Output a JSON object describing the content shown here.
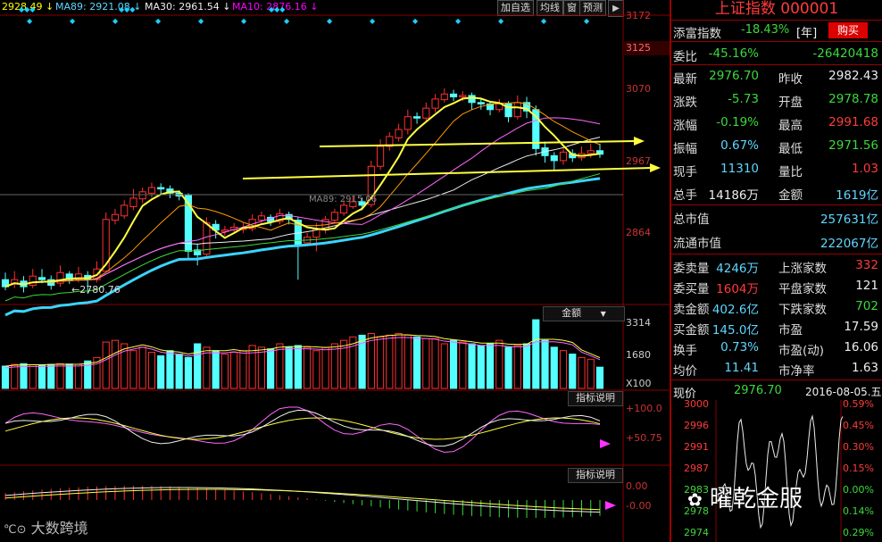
{
  "header": {
    "ma_items": [
      {
        "text": "2928.49 ↓",
        "color": "#ff0"
      },
      {
        "text": "MA89: 2921.08 ↓",
        "color": "#5fd7ff"
      },
      {
        "text": "MA30: 2961.54 ↓",
        "color": "#eee"
      },
      {
        "text": "MA10: 2876.16 ↓",
        "color": "#f0f"
      }
    ],
    "buttons": [
      "加自选",
      "均线",
      "窗",
      "预测"
    ],
    "nav_arrow": "▶"
  },
  "price_axis": [
    "3172",
    "3125",
    "3070",
    "2967",
    "2864"
  ],
  "low_annotation": "←2780.76",
  "ma_annotation": "MA89: 2915.06",
  "volume_panel": {
    "label": "金额",
    "axis": [
      "3314",
      "1680",
      "X100"
    ]
  },
  "indicator1": {
    "label": "指标说明",
    "axis": [
      "+100.0",
      "+50.75"
    ]
  },
  "indicator2": {
    "label": "指标说明",
    "axis": [
      "0.00",
      "-0.00"
    ]
  },
  "watermark_left": "大数跨境",
  "watermark_right": "曜乾金服",
  "quote": {
    "title": "上证指数 000001",
    "buy_label": "添富指数",
    "buy_value": "-18.43%",
    "buy_unit": "[年]",
    "buy_button": "购买",
    "rows1": [
      {
        "l": "委比",
        "v": "-45.16%",
        "vc": "grn",
        "l2": "",
        "v2": "-26420418",
        "v2c": "grn"
      }
    ],
    "rows2": [
      {
        "l": "最新",
        "v": "2976.70",
        "vc": "grn",
        "l2": "昨收",
        "v2": "2982.43",
        "v2c": "wht"
      },
      {
        "l": "涨跌",
        "v": "-5.73",
        "vc": "grn",
        "l2": "开盘",
        "v2": "2978.78",
        "v2c": "grn"
      },
      {
        "l": "涨幅",
        "v": "-0.19%",
        "vc": "grn",
        "l2": "最高",
        "v2": "2991.68",
        "v2c": "red"
      },
      {
        "l": "振幅",
        "v": "0.67%",
        "vc": "cy",
        "l2": "最低",
        "v2": "2971.56",
        "v2c": "grn"
      },
      {
        "l": "现手",
        "v": "11310",
        "vc": "cy",
        "l2": "量比",
        "v2": "1.03",
        "v2c": "red"
      },
      {
        "l": "总手",
        "v": "14186万",
        "vc": "wht",
        "l2": "金额",
        "v2": "1619亿",
        "v2c": "cy"
      }
    ],
    "rows3": [
      {
        "l": "总市值",
        "v2": "257631亿",
        "v2c": "cy"
      },
      {
        "l": "流通市值",
        "v2": "222067亿",
        "v2c": "cy"
      }
    ],
    "rows4": [
      {
        "l": "委卖量",
        "v": "4246万",
        "vc": "cy",
        "l2": "上涨家数",
        "v2": "332",
        "v2c": "red"
      },
      {
        "l": "委买量",
        "v": "1604万",
        "vc": "red",
        "l2": "平盘家数",
        "v2": "121",
        "v2c": "wht"
      },
      {
        "l": "卖金额",
        "v": "402.6亿",
        "vc": "cy",
        "l2": "下跌家数",
        "v2": "702",
        "v2c": "grn"
      },
      {
        "l": "买金额",
        "v": "145.0亿",
        "vc": "cy",
        "l2": "市盈",
        "v2": "17.59",
        "v2c": "wht"
      },
      {
        "l": "换手",
        "v": "0.73%",
        "vc": "cy",
        "l2": "市盈(动)",
        "v2": "16.06",
        "v2c": "wht"
      },
      {
        "l": "均价",
        "v": "11.41",
        "vc": "cy",
        "l2": "市净率",
        "v2": "1.63",
        "v2c": "wht"
      }
    ],
    "mini": {
      "label": "现价",
      "price": "2976.70",
      "date": "2016-08-05.五",
      "left_axis": [
        "3000",
        "2996",
        "2991",
        "2987",
        "2983",
        "2978",
        "2974"
      ],
      "right_axis": [
        "0.59%",
        "0.45%",
        "0.30%",
        "0.15%",
        "0.00%",
        "0.14%",
        "0.29%"
      ]
    }
  },
  "chart_data": {
    "type": "candlestick",
    "price_range": [
      2770,
      3172
    ],
    "candles": [
      [
        2800,
        2790,
        2810,
        2785
      ],
      [
        2795,
        2800,
        2812,
        2788
      ],
      [
        2798,
        2790,
        2805,
        2782
      ],
      [
        2792,
        2805,
        2815,
        2788
      ],
      [
        2803,
        2800,
        2815,
        2795
      ],
      [
        2800,
        2792,
        2806,
        2786
      ],
      [
        2795,
        2810,
        2820,
        2790
      ],
      [
        2808,
        2800,
        2812,
        2794
      ],
      [
        2800,
        2808,
        2818,
        2796
      ],
      [
        2806,
        2800,
        2812,
        2780
      ],
      [
        2800,
        2815,
        2826,
        2796
      ],
      [
        2812,
        2885,
        2895,
        2810
      ],
      [
        2884,
        2892,
        2900,
        2878
      ],
      [
        2890,
        2905,
        2912,
        2886
      ],
      [
        2903,
        2915,
        2928,
        2898
      ],
      [
        2914,
        2924,
        2930,
        2908
      ],
      [
        2922,
        2930,
        2937,
        2916
      ],
      [
        2930,
        2928,
        2936,
        2920
      ],
      [
        2928,
        2922,
        2933,
        2915
      ],
      [
        2922,
        2918,
        2926,
        2912
      ],
      [
        2920,
        2840,
        2922,
        2830
      ],
      [
        2842,
        2835,
        2850,
        2820
      ],
      [
        2836,
        2880,
        2888,
        2830
      ],
      [
        2878,
        2870,
        2884,
        2858
      ],
      [
        2868,
        2870,
        2876,
        2862
      ],
      [
        2870,
        2874,
        2880,
        2866
      ],
      [
        2872,
        2872,
        2880,
        2866
      ],
      [
        2872,
        2885,
        2892,
        2868
      ],
      [
        2884,
        2890,
        2896,
        2880
      ],
      [
        2888,
        2882,
        2892,
        2876
      ],
      [
        2882,
        2893,
        2900,
        2878
      ],
      [
        2892,
        2885,
        2896,
        2878
      ],
      [
        2884,
        2850,
        2888,
        2800
      ],
      [
        2852,
        2860,
        2866,
        2848
      ],
      [
        2860,
        2872,
        2880,
        2840
      ],
      [
        2870,
        2885,
        2890,
        2865
      ],
      [
        2884,
        2895,
        2900,
        2880
      ],
      [
        2894,
        2905,
        2912,
        2890
      ],
      [
        2903,
        2910,
        2918,
        2900
      ],
      [
        2910,
        2905,
        2916,
        2898
      ],
      [
        2906,
        2960,
        2968,
        2902
      ],
      [
        2960,
        2988,
        2998,
        2955
      ],
      [
        2988,
        3002,
        3008,
        2982
      ],
      [
        3000,
        3012,
        3020,
        2995
      ],
      [
        3012,
        3030,
        3040,
        3005
      ],
      [
        3030,
        3028,
        3036,
        3020
      ],
      [
        3028,
        3042,
        3050,
        3022
      ],
      [
        3042,
        3055,
        3062,
        3036
      ],
      [
        3054,
        3062,
        3070,
        3050
      ],
      [
        3062,
        3058,
        3068,
        3052
      ],
      [
        3058,
        3060,
        3066,
        3052
      ],
      [
        3060,
        3050,
        3064,
        3040
      ],
      [
        3050,
        3048,
        3056,
        3040
      ],
      [
        3048,
        3040,
        3052,
        3032
      ],
      [
        3040,
        3048,
        3055,
        3036
      ],
      [
        3048,
        3030,
        3052,
        3022
      ],
      [
        3030,
        3050,
        3060,
        3026
      ],
      [
        3050,
        3038,
        3058,
        3028
      ],
      [
        3040,
        2985,
        3046,
        2975
      ],
      [
        2986,
        2975,
        2995,
        2965
      ],
      [
        2975,
        2968,
        2980,
        2955
      ],
      [
        2968,
        2980,
        2986,
        2962
      ],
      [
        2978,
        2972,
        2984,
        2966
      ],
      [
        2972,
        2978,
        2988,
        2968
      ],
      [
        2978,
        2982,
        2992,
        2972
      ],
      [
        2982,
        2977,
        2992,
        2972
      ]
    ],
    "amount_values": [
      1650,
      1700,
      1720,
      1690,
      1690,
      1700,
      1720,
      1710,
      1700,
      1800,
      1900,
      2350,
      2400,
      2300,
      2100,
      2200,
      2050,
      1950,
      2100,
      2000,
      1900,
      2300,
      2200,
      2100,
      2000,
      2050,
      2100,
      2250,
      2200,
      2150,
      2300,
      2200,
      2250,
      2200,
      2100,
      2200,
      2300,
      2400,
      2500,
      2550,
      2600,
      2500,
      2550,
      2600,
      2550,
      2500,
      2450,
      2450,
      2300,
      2400,
      2350,
      2300,
      2250,
      2300,
      2400,
      2200,
      2250,
      2300,
      3000,
      2400,
      2200,
      2100,
      2000,
      1900,
      1850,
      1619
    ]
  }
}
